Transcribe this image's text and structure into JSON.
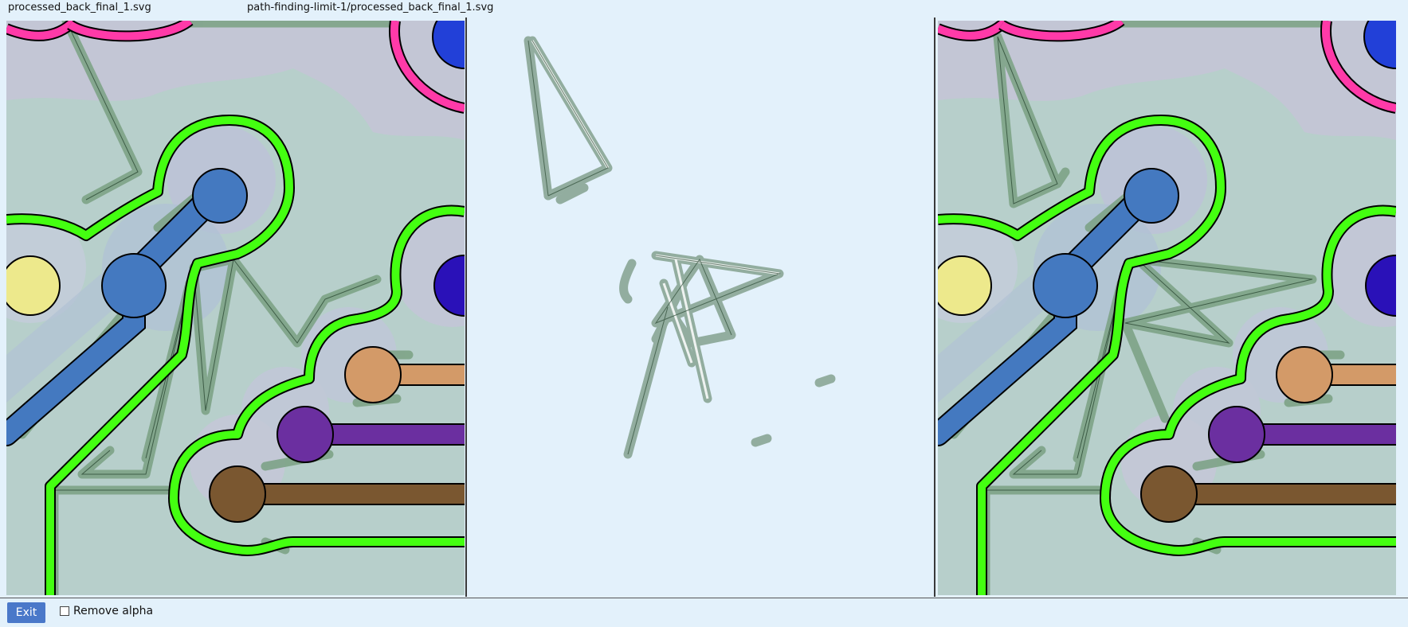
{
  "window": {
    "left_title": "processed_back_final_1.svg",
    "diff_title": "path-finding-limit-1/processed_back_final_1.svg"
  },
  "controls": {
    "exit_label": "Exit",
    "remove_alpha_label": "Remove alpha",
    "remove_alpha_checked": false
  },
  "colors": {
    "background": "#e3f1fb",
    "board_fill": "#b7cfcb",
    "board_upper": "#c3c6d5",
    "green_trace": "#44ff11",
    "pink_trace": "#ff3aa8",
    "blue_net": "#4479c0",
    "yellow_pad": "#ede98c",
    "orange_net": "#d39a68",
    "purple_net": "#6b2fa0",
    "brown_net": "#7a5730",
    "dark_blue_pad": "#2a11b8",
    "route_shade": "#7aa183"
  }
}
